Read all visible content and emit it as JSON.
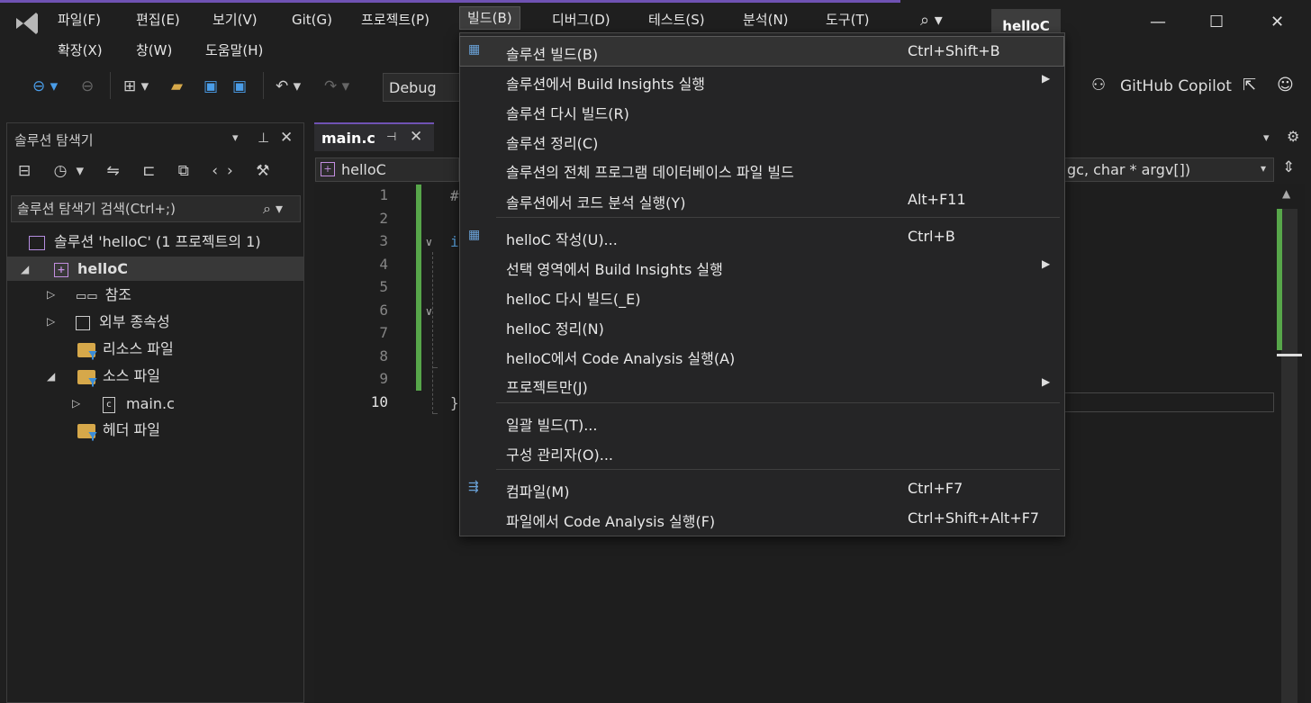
{
  "menubar": {
    "row1": [
      "파일(F)",
      "편집(E)",
      "보기(V)",
      "Git(G)",
      "프로젝트(P)",
      "빌드(B)",
      "디버그(D)",
      "테스트(S)",
      "분석(N)",
      "도구(T)"
    ],
    "row2": [
      "확장(X)",
      "창(W)",
      "도움말(H)"
    ],
    "title": "helloC"
  },
  "toolbar": {
    "config": "Debug",
    "copilot": "GitHub Copilot"
  },
  "solution_explorer": {
    "title": "솔루션 탐색기",
    "search_placeholder": "솔루션 탐색기 검색(Ctrl+;)",
    "solution": "솔루션 'helloC' (1 프로젝트의 1)",
    "project": "helloC",
    "items": {
      "refs": "참조",
      "ext": "외부 종속성",
      "res": "리소스 파일",
      "src": "소스 파일",
      "main": "main.c",
      "hdr": "헤더 파일"
    }
  },
  "editor": {
    "tab": "main.c",
    "nav_left": "helloC",
    "nav_right": "gc, char * argv[])",
    "line_numbers": [
      "1",
      "2",
      "3",
      "4",
      "5",
      "6",
      "7",
      "8",
      "9",
      "10"
    ]
  },
  "build_menu": {
    "items": [
      {
        "label": "솔루션 빌드(B)",
        "shortcut": "Ctrl+Shift+B"
      },
      {
        "label": "솔루션에서 Build Insights 실행",
        "shortcut": ""
      },
      {
        "label": "솔루션 다시 빌드(R)",
        "shortcut": ""
      },
      {
        "label": "솔루션 정리(C)",
        "shortcut": ""
      },
      {
        "label": "솔루션의 전체 프로그램 데이터베이스 파일 빌드",
        "shortcut": ""
      },
      {
        "label": "솔루션에서 코드 분석 실행(Y)",
        "shortcut": "Alt+F11"
      },
      {
        "label": "helloC 작성(U)...",
        "shortcut": "Ctrl+B"
      },
      {
        "label": "선택 영역에서 Build Insights 실행",
        "shortcut": ""
      },
      {
        "label": "helloC 다시 빌드(_E)",
        "shortcut": ""
      },
      {
        "label": "helloC 정리(N)",
        "shortcut": ""
      },
      {
        "label": "helloC에서 Code Analysis 실행(A)",
        "shortcut": ""
      },
      {
        "label": "프로젝트만(J)",
        "shortcut": ""
      },
      {
        "label": "일괄 빌드(T)...",
        "shortcut": ""
      },
      {
        "label": "구성 관리자(O)...",
        "shortcut": ""
      },
      {
        "label": "컴파일(M)",
        "shortcut": "Ctrl+F7"
      },
      {
        "label": "파일에서 Code Analysis 실행(F)",
        "shortcut": "Ctrl+Shift+Alt+F7"
      }
    ]
  }
}
